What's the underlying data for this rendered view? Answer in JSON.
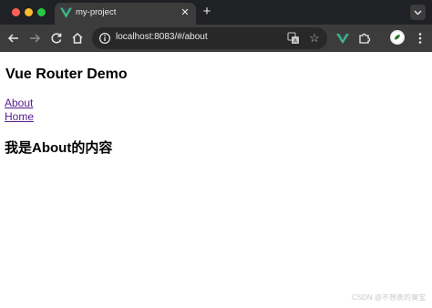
{
  "browser": {
    "tab": {
      "title": "my-project",
      "close_glyph": "✕"
    },
    "new_tab_glyph": "+",
    "toolbar": {
      "url": "localhost:8083/#/about",
      "star_glyph": "☆"
    },
    "icons": {
      "favicon": "vue-logo-icon",
      "back": "back-arrow-icon",
      "forward": "forward-arrow-icon",
      "reload": "reload-icon",
      "home": "home-icon",
      "site_info": "site-info-icon",
      "translate": "translate-icon",
      "bookmark": "star-icon",
      "vue_devtools": "vue-devtools-icon",
      "extensions": "puzzle-piece-icon",
      "profile": "avatar-icon",
      "menu": "kebab-menu-icon",
      "tab_search": "chevron-down-icon"
    },
    "colors": {
      "tabbar_bg": "#202124",
      "toolbar_bg": "#3c3c3c",
      "vue_green": "#42b883",
      "link_visited": "#551a8b"
    }
  },
  "page": {
    "title": "Vue Router Demo",
    "nav_links": [
      "About",
      "Home"
    ],
    "view_heading": "我是About的内容"
  },
  "watermark": "CSDN @不想表的臭宝"
}
